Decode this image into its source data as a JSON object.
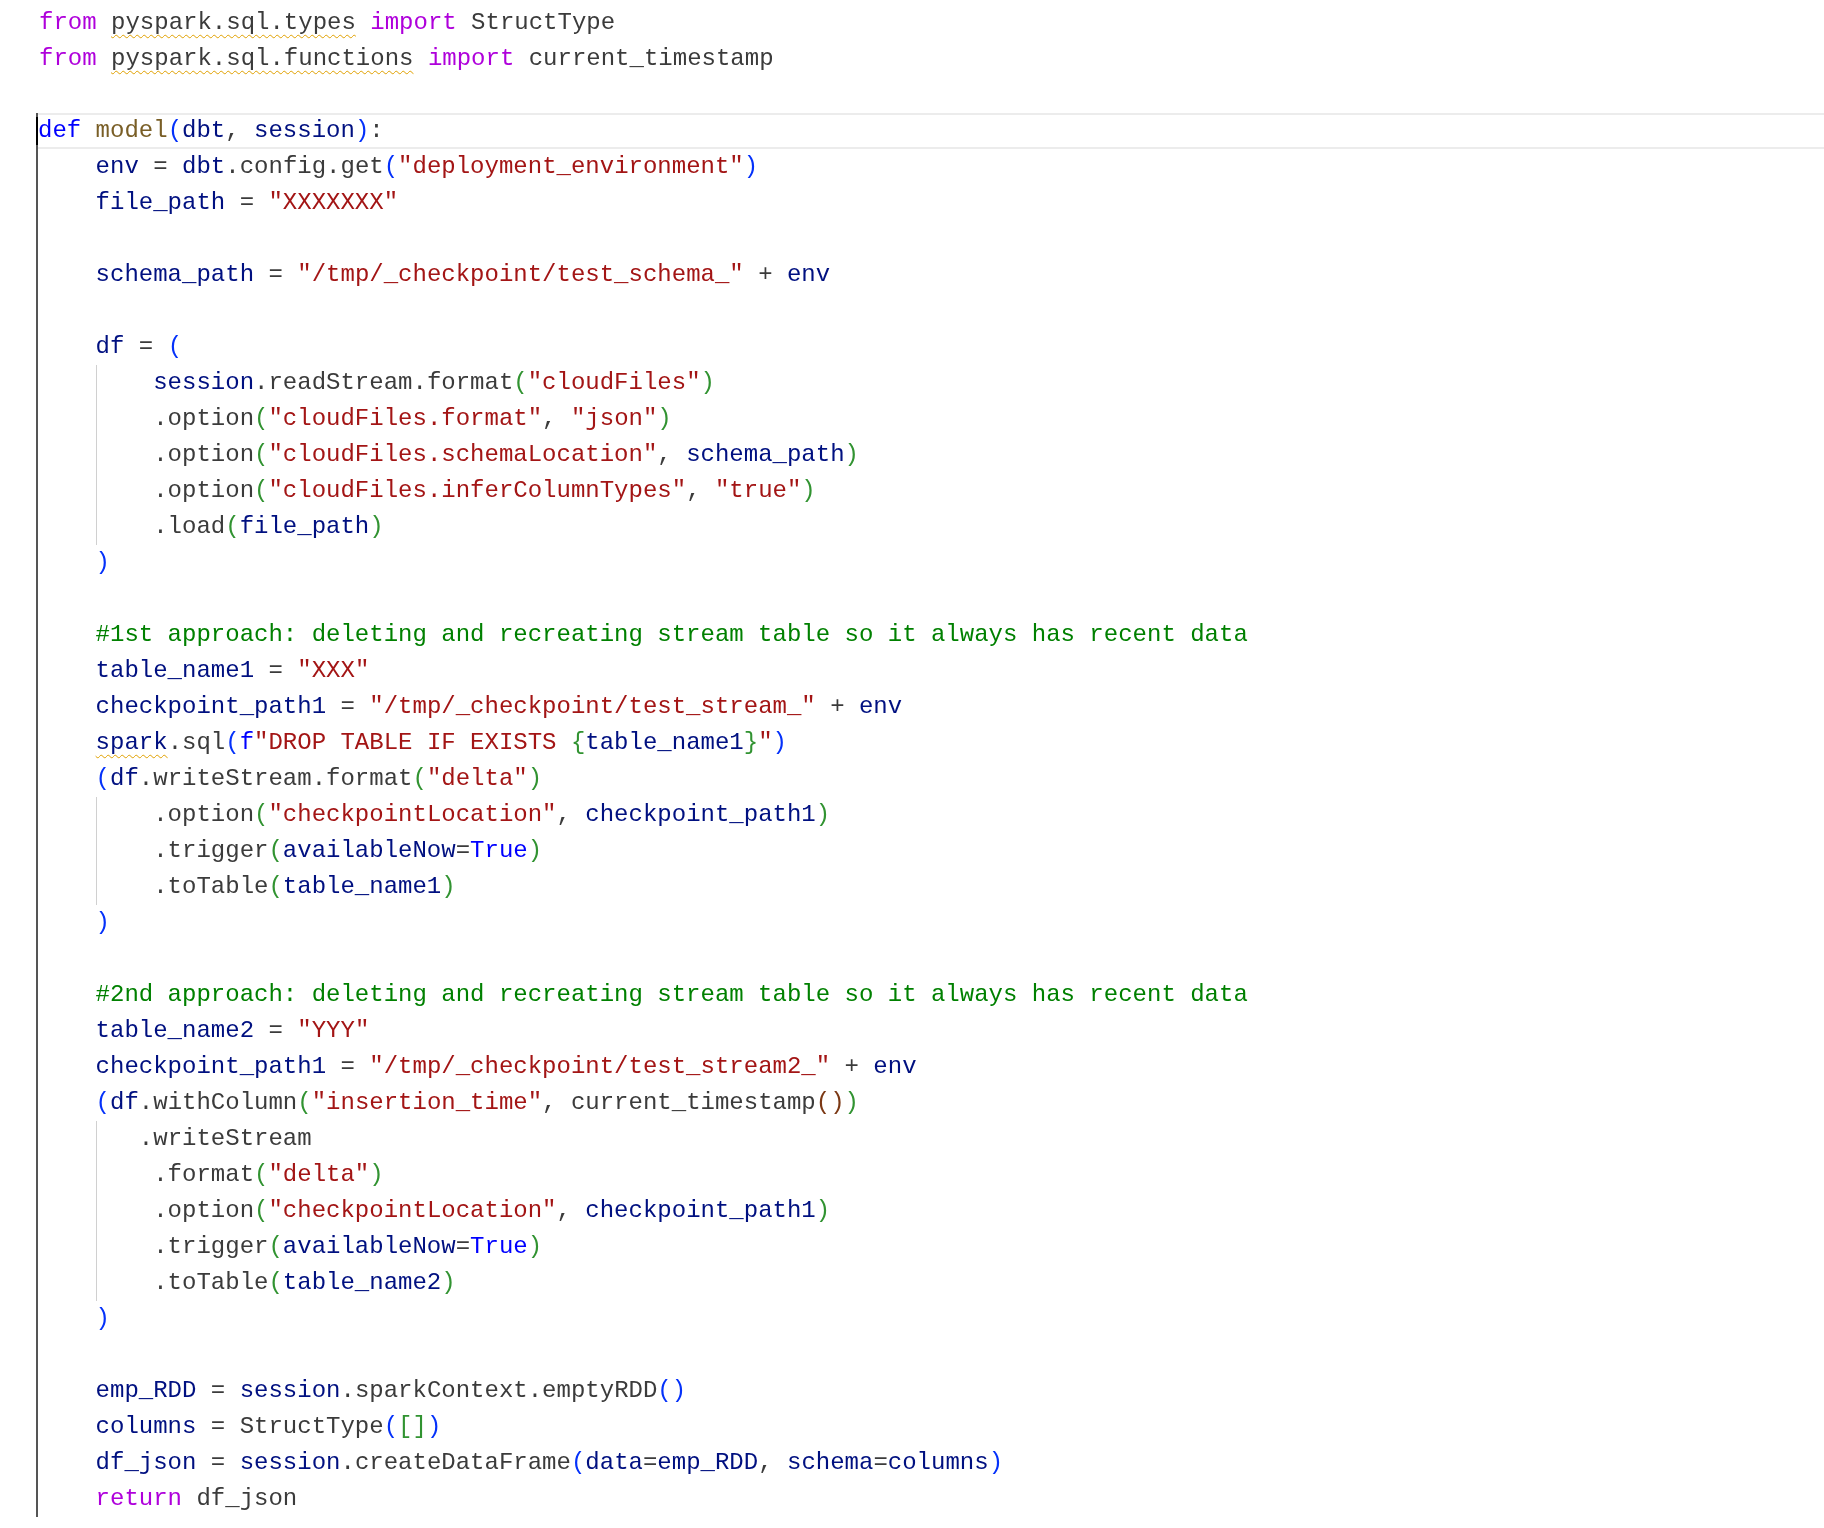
{
  "editor": {
    "imports": [
      {
        "current": false,
        "tokens": [
          {
            "text": "from ",
            "kind": "kw"
          },
          {
            "text": "pyspark.sql.types",
            "kind": "warn"
          },
          {
            "text": " import",
            "kind": "kw"
          },
          {
            "text": " StructType",
            "kind": "txt"
          }
        ]
      },
      {
        "current": false,
        "tokens": [
          {
            "text": "from ",
            "kind": "kw"
          },
          {
            "text": "pyspark.sql.functions",
            "kind": "warn"
          },
          {
            "text": " import",
            "kind": "kw"
          },
          {
            "text": " current_timestamp",
            "kind": "txt"
          }
        ]
      },
      {
        "current": false
      }
    ],
    "function": [
      {
        "current": true,
        "tokens": [
          {
            "text": "def ",
            "kind": "def"
          },
          {
            "text": "model",
            "kind": "fn"
          },
          {
            "text": "(",
            "kind": "b1"
          },
          {
            "text": "dbt",
            "kind": "var"
          },
          {
            "text": ", ",
            "kind": "txt"
          },
          {
            "text": "session",
            "kind": "var"
          },
          {
            "text": ")",
            "kind": "b1"
          },
          {
            "text": ":",
            "kind": "txt"
          }
        ]
      },
      {
        "current": false,
        "tokens": [
          {
            "text": "    env",
            "kind": "var"
          },
          {
            "text": " = ",
            "kind": "txt"
          },
          {
            "text": "dbt",
            "kind": "var"
          },
          {
            "text": ".config.get",
            "kind": "txt"
          },
          {
            "text": "(",
            "kind": "b1"
          },
          {
            "text": "\"deployment_environment\"",
            "kind": "str"
          },
          {
            "text": ")",
            "kind": "b1"
          }
        ]
      },
      {
        "current": false,
        "tokens": [
          {
            "text": "    file_path",
            "kind": "var"
          },
          {
            "text": " = ",
            "kind": "txt"
          },
          {
            "text": "\"XXXXXXX\"",
            "kind": "str"
          }
        ]
      },
      {
        "current": false
      },
      {
        "current": false,
        "tokens": [
          {
            "text": "    schema_path",
            "kind": "var"
          },
          {
            "text": " = ",
            "kind": "txt"
          },
          {
            "text": "\"/tmp/_checkpoint/test_schema_\"",
            "kind": "str"
          },
          {
            "text": " + ",
            "kind": "txt"
          },
          {
            "text": "env",
            "kind": "var"
          }
        ]
      },
      {
        "current": false
      },
      {
        "current": false,
        "tokens": [
          {
            "text": "    df",
            "kind": "var"
          },
          {
            "text": " = ",
            "kind": "txt"
          },
          {
            "text": "(",
            "kind": "b1"
          }
        ]
      },
      {
        "current": false,
        "tokens": [
          {
            "text": "        session",
            "kind": "var"
          },
          {
            "text": ".readStream.format",
            "kind": "txt"
          },
          {
            "text": "(",
            "kind": "b2"
          },
          {
            "text": "\"cloudFiles\"",
            "kind": "str"
          },
          {
            "text": ")",
            "kind": "b2"
          }
        ]
      },
      {
        "current": false,
        "tokens": [
          {
            "text": "        .option",
            "kind": "txt"
          },
          {
            "text": "(",
            "kind": "b2"
          },
          {
            "text": "\"cloudFiles.format\"",
            "kind": "str"
          },
          {
            "text": ", ",
            "kind": "txt"
          },
          {
            "text": "\"json\"",
            "kind": "str"
          },
          {
            "text": ")",
            "kind": "b2"
          }
        ]
      },
      {
        "current": false,
        "tokens": [
          {
            "text": "        .option",
            "kind": "txt"
          },
          {
            "text": "(",
            "kind": "b2"
          },
          {
            "text": "\"cloudFiles.schemaLocation\"",
            "kind": "str"
          },
          {
            "text": ", ",
            "kind": "txt"
          },
          {
            "text": "schema_path",
            "kind": "var"
          },
          {
            "text": ")",
            "kind": "b2"
          }
        ]
      },
      {
        "current": false,
        "tokens": [
          {
            "text": "        .option",
            "kind": "txt"
          },
          {
            "text": "(",
            "kind": "b2"
          },
          {
            "text": "\"cloudFiles.inferColumnTypes\"",
            "kind": "str"
          },
          {
            "text": ", ",
            "kind": "txt"
          },
          {
            "text": "\"true\"",
            "kind": "str"
          },
          {
            "text": ")",
            "kind": "b2"
          }
        ]
      },
      {
        "current": false,
        "tokens": [
          {
            "text": "        .load",
            "kind": "txt"
          },
          {
            "text": "(",
            "kind": "b2"
          },
          {
            "text": "file_path",
            "kind": "var"
          },
          {
            "text": ")",
            "kind": "b2"
          }
        ]
      },
      {
        "current": false,
        "tokens": [
          {
            "text": "    )",
            "kind": "b1"
          }
        ]
      },
      {
        "current": false
      },
      {
        "current": false,
        "tokens": [
          {
            "text": "    #1st approach: deleting and recreating stream table so it always has recent data",
            "kind": "com"
          }
        ]
      },
      {
        "current": false,
        "tokens": [
          {
            "text": "    table_name1",
            "kind": "var"
          },
          {
            "text": " = ",
            "kind": "txt"
          },
          {
            "text": "\"XXX\"",
            "kind": "str"
          }
        ]
      },
      {
        "current": false,
        "tokens": [
          {
            "text": "    checkpoint_path1",
            "kind": "var"
          },
          {
            "text": " = ",
            "kind": "txt"
          },
          {
            "text": "\"/tmp/_checkpoint/test_stream_\"",
            "kind": "str"
          },
          {
            "text": " + ",
            "kind": "txt"
          },
          {
            "text": "env",
            "kind": "var"
          }
        ]
      },
      {
        "current": false,
        "tokens": [
          {
            "text": "    spark",
            "kind": "warnvar"
          },
          {
            "text": ".sql",
            "kind": "txt"
          },
          {
            "text": "(",
            "kind": "b1"
          },
          {
            "text": "f",
            "kind": "def"
          },
          {
            "text": "\"DROP TABLE IF EXISTS ",
            "kind": "str"
          },
          {
            "text": "{",
            "kind": "b2"
          },
          {
            "text": "table_name1",
            "kind": "var"
          },
          {
            "text": "}",
            "kind": "b2"
          },
          {
            "text": "\"",
            "kind": "str"
          },
          {
            "text": ")",
            "kind": "b1"
          }
        ]
      },
      {
        "current": false,
        "tokens": [
          {
            "text": "    (",
            "kind": "b1"
          },
          {
            "text": "df",
            "kind": "var"
          },
          {
            "text": ".writeStream.format",
            "kind": "txt"
          },
          {
            "text": "(",
            "kind": "b2"
          },
          {
            "text": "\"delta\"",
            "kind": "str"
          },
          {
            "text": ")",
            "kind": "b2"
          }
        ]
      },
      {
        "current": false,
        "tokens": [
          {
            "text": "        .option",
            "kind": "txt"
          },
          {
            "text": "(",
            "kind": "b2"
          },
          {
            "text": "\"checkpointLocation\"",
            "kind": "str"
          },
          {
            "text": ", ",
            "kind": "txt"
          },
          {
            "text": "checkpoint_path1",
            "kind": "var"
          },
          {
            "text": ")",
            "kind": "b2"
          }
        ]
      },
      {
        "current": false,
        "tokens": [
          {
            "text": "        .trigger",
            "kind": "txt"
          },
          {
            "text": "(",
            "kind": "b2"
          },
          {
            "text": "availableNow",
            "kind": "var"
          },
          {
            "text": "=",
            "kind": "txt"
          },
          {
            "text": "True",
            "kind": "const"
          },
          {
            "text": ")",
            "kind": "b2"
          }
        ]
      },
      {
        "current": false,
        "tokens": [
          {
            "text": "        .toTable",
            "kind": "txt"
          },
          {
            "text": "(",
            "kind": "b2"
          },
          {
            "text": "table_name1",
            "kind": "var"
          },
          {
            "text": ")",
            "kind": "b2"
          }
        ]
      },
      {
        "current": false,
        "tokens": [
          {
            "text": "    )",
            "kind": "b1"
          }
        ]
      },
      {
        "current": false
      },
      {
        "current": false,
        "tokens": [
          {
            "text": "    #2nd approach: deleting and recreating stream table so it always has recent data",
            "kind": "com"
          }
        ]
      },
      {
        "current": false,
        "tokens": [
          {
            "text": "    table_name2",
            "kind": "var"
          },
          {
            "text": " = ",
            "kind": "txt"
          },
          {
            "text": "\"YYY\"",
            "kind": "str"
          }
        ]
      },
      {
        "current": false,
        "tokens": [
          {
            "text": "    checkpoint_path1",
            "kind": "var"
          },
          {
            "text": " = ",
            "kind": "txt"
          },
          {
            "text": "\"/tmp/_checkpoint/test_stream2_\"",
            "kind": "str"
          },
          {
            "text": " + ",
            "kind": "txt"
          },
          {
            "text": "env",
            "kind": "var"
          }
        ]
      },
      {
        "current": false,
        "tokens": [
          {
            "text": "    (",
            "kind": "b1"
          },
          {
            "text": "df",
            "kind": "var"
          },
          {
            "text": ".withColumn",
            "kind": "txt"
          },
          {
            "text": "(",
            "kind": "b2"
          },
          {
            "text": "\"insertion_time\"",
            "kind": "str"
          },
          {
            "text": ", current_timestamp",
            "kind": "txt"
          },
          {
            "text": "()",
            "kind": "b3"
          },
          {
            "text": ")",
            "kind": "b2"
          }
        ]
      },
      {
        "current": false,
        "tokens": [
          {
            "text": "       .writeStream",
            "kind": "txt"
          }
        ]
      },
      {
        "current": false,
        "tokens": [
          {
            "text": "        .format",
            "kind": "txt"
          },
          {
            "text": "(",
            "kind": "b2"
          },
          {
            "text": "\"delta\"",
            "kind": "str"
          },
          {
            "text": ")",
            "kind": "b2"
          }
        ]
      },
      {
        "current": false,
        "tokens": [
          {
            "text": "        .option",
            "kind": "txt"
          },
          {
            "text": "(",
            "kind": "b2"
          },
          {
            "text": "\"checkpointLocation\"",
            "kind": "str"
          },
          {
            "text": ", ",
            "kind": "txt"
          },
          {
            "text": "checkpoint_path1",
            "kind": "var"
          },
          {
            "text": ")",
            "kind": "b2"
          }
        ]
      },
      {
        "current": false,
        "tokens": [
          {
            "text": "        .trigger",
            "kind": "txt"
          },
          {
            "text": "(",
            "kind": "b2"
          },
          {
            "text": "availableNow",
            "kind": "var"
          },
          {
            "text": "=",
            "kind": "txt"
          },
          {
            "text": "True",
            "kind": "const"
          },
          {
            "text": ")",
            "kind": "b2"
          }
        ]
      },
      {
        "current": false,
        "tokens": [
          {
            "text": "        .toTable",
            "kind": "txt"
          },
          {
            "text": "(",
            "kind": "b2"
          },
          {
            "text": "table_name2",
            "kind": "var"
          },
          {
            "text": ")",
            "kind": "b2"
          }
        ]
      },
      {
        "current": false,
        "tokens": [
          {
            "text": "    )",
            "kind": "b1"
          }
        ]
      },
      {
        "current": false
      },
      {
        "current": false,
        "tokens": [
          {
            "text": "    emp_RDD",
            "kind": "var"
          },
          {
            "text": " = ",
            "kind": "txt"
          },
          {
            "text": "session",
            "kind": "var"
          },
          {
            "text": ".sparkContext.emptyRDD",
            "kind": "txt"
          },
          {
            "text": "()",
            "kind": "b1"
          }
        ]
      },
      {
        "current": false,
        "tokens": [
          {
            "text": "    columns",
            "kind": "var"
          },
          {
            "text": " = StructType",
            "kind": "txt"
          },
          {
            "text": "(",
            "kind": "b1"
          },
          {
            "text": "[]",
            "kind": "b2"
          },
          {
            "text": ")",
            "kind": "b1"
          }
        ]
      },
      {
        "current": false,
        "tokens": [
          {
            "text": "    df_json",
            "kind": "var"
          },
          {
            "text": " = ",
            "kind": "txt"
          },
          {
            "text": "session",
            "kind": "var"
          },
          {
            "text": ".createDataFrame",
            "kind": "txt"
          },
          {
            "text": "(",
            "kind": "b1"
          },
          {
            "text": "data",
            "kind": "var"
          },
          {
            "text": "=",
            "kind": "txt"
          },
          {
            "text": "emp_RDD",
            "kind": "var"
          },
          {
            "text": ", ",
            "kind": "txt"
          },
          {
            "text": "schema",
            "kind": "var"
          },
          {
            "text": "=",
            "kind": "txt"
          },
          {
            "text": "columns",
            "kind": "var"
          },
          {
            "text": ")",
            "kind": "b1"
          }
        ]
      },
      {
        "current": false,
        "tokens": [
          {
            "text": "    return",
            "kind": "kw"
          },
          {
            "text": " df_json",
            "kind": "txt"
          }
        ]
      }
    ]
  }
}
